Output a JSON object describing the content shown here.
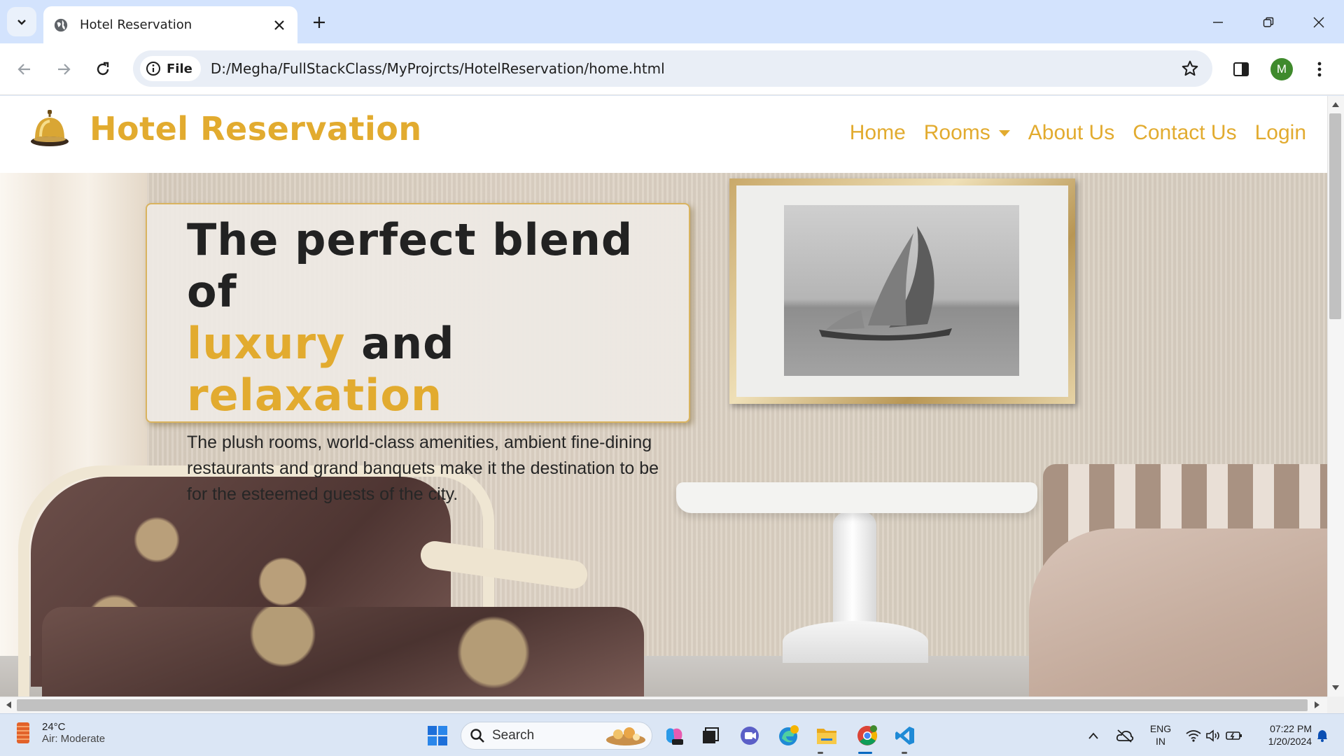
{
  "browser": {
    "tab_title": "Hotel Reservation",
    "chip_label": "File",
    "url": "D:/Megha/FullStackClass/MyProjrcts/HotelReservation/home.html",
    "profile_initial": "M"
  },
  "site": {
    "brand": "Hotel Reservation",
    "nav": {
      "home": "Home",
      "rooms": "Rooms",
      "about": "About Us",
      "contact": "Contact Us",
      "login": "Login"
    },
    "hero": {
      "line1": "The perfect blend of",
      "word1": "luxury",
      "word_and": "and",
      "word2": "relaxation",
      "paragraph": "The plush rooms, world-class amenities, ambient fine-dining restaurants and grand banquets make it the destination to be for the esteemed guests of the city."
    }
  },
  "taskbar": {
    "temperature": "24°C",
    "air": "Air: Moderate",
    "search_label": "Search",
    "lang1": "ENG",
    "lang2": "IN",
    "time": "07:22 PM",
    "date": "1/20/2024"
  },
  "colors": {
    "accent_gold": "#e2ab2f",
    "tab_strip": "#d3e3fd",
    "avatar_green": "#3f8a2c"
  },
  "icons": [
    "tab-search-icon",
    "globe-icon",
    "close-icon",
    "plus-icon",
    "minimize-icon",
    "restore-icon",
    "window-close-icon",
    "back-icon",
    "forward-icon",
    "reload-icon",
    "info-icon",
    "star-icon",
    "side-panel-icon",
    "menu-dots-icon",
    "bell-logo-icon",
    "weather-icon",
    "windows-start-icon",
    "search-icon",
    "wifi-icon",
    "volume-icon",
    "battery-icon",
    "notification-bell-icon"
  ]
}
